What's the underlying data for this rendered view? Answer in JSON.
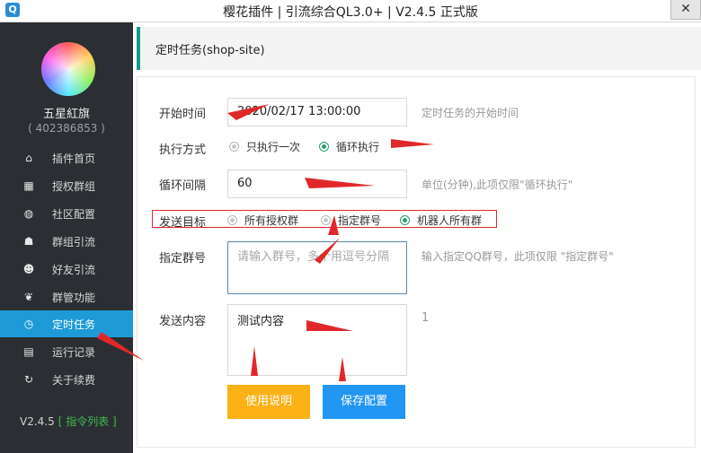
{
  "window": {
    "title": "樱花插件 | 引流综合QL3.0+ | V2.4.5 正式版",
    "close": "✕"
  },
  "user": {
    "name": "五星紅旗",
    "id": "( 402386853 )"
  },
  "nav": [
    {
      "label": "插件首页",
      "icon": "home-icon",
      "glyph": "⌂"
    },
    {
      "label": "授权群组",
      "icon": "grid-icon",
      "glyph": "▦"
    },
    {
      "label": "社区配置",
      "icon": "globe-icon",
      "glyph": "◍"
    },
    {
      "label": "群组引流",
      "icon": "users-icon",
      "glyph": "☗"
    },
    {
      "label": "好友引流",
      "icon": "user-icon",
      "glyph": "☻"
    },
    {
      "label": "群管功能",
      "icon": "bird-icon",
      "glyph": "❦"
    },
    {
      "label": "定时任务",
      "icon": "clock-icon",
      "glyph": "◷"
    },
    {
      "label": "运行记录",
      "icon": "log-icon",
      "glyph": "▤"
    },
    {
      "label": "关于续费",
      "icon": "refresh-icon",
      "glyph": "↻"
    }
  ],
  "footer": {
    "version": "V2.4.5",
    "commands": "[ 指令列表 ]"
  },
  "page": {
    "title": "定时任务(shop-site)"
  },
  "form": {
    "start_time": {
      "label": "开始时间",
      "value": "2020/02/17 13:00:00",
      "hint": "定时任务的开始时间"
    },
    "mode": {
      "label": "执行方式",
      "options": [
        "只执行一次",
        "循环执行"
      ],
      "selected": "循环执行"
    },
    "interval": {
      "label": "循环间隔",
      "value": "60",
      "hint": "单位(分钟),此项仅限\"循环执行\""
    },
    "target": {
      "label": "发送目标",
      "options": [
        "所有授权群",
        "指定群号",
        "机器人所有群"
      ],
      "selected": "机器人所有群"
    },
    "group_ids": {
      "label": "指定群号",
      "placeholder": "请输入群号，多个用逗号分隔",
      "hint": "输入指定QQ群号，此项仅限 \"指定群号\""
    },
    "content": {
      "label": "发送内容",
      "value": "测试内容",
      "count": "1"
    }
  },
  "buttons": {
    "help": "使用说明",
    "save": "保存配置"
  },
  "colors": {
    "accent": "#1e9bd7",
    "sidebar": "#2b2f33",
    "header_bar": "#159a8a",
    "annotation": "#e0282a",
    "help_button": "#fcb116",
    "save_button": "#2196f3"
  }
}
